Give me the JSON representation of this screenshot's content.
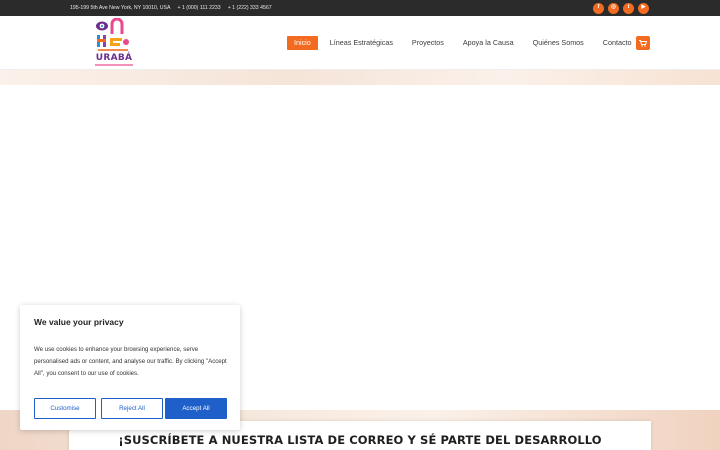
{
  "topbar": {
    "address": "195-199 5th Ave New York, NY 10010, USA",
    "phone1": "+ 1 (000) 111 2233",
    "phone2": "+ 1 (222) 333 4567",
    "social": [
      {
        "icon": "facebook-icon",
        "glyph": "f"
      },
      {
        "icon": "instagram-icon",
        "glyph": "◎"
      },
      {
        "icon": "twitter-icon",
        "glyph": "t"
      },
      {
        "icon": "youtube-icon",
        "glyph": "▶"
      }
    ]
  },
  "header": {
    "logo_text": "URABÁ",
    "nav": [
      {
        "label": "Inicio",
        "active": true
      },
      {
        "label": "Líneas Estratégicas",
        "active": false
      },
      {
        "label": "Proyectos",
        "active": false
      },
      {
        "label": "Apoya la Causa",
        "active": false
      },
      {
        "label": "Quiénes Somos",
        "active": false
      },
      {
        "label": "Contacto",
        "active": false
      }
    ],
    "cart_icon": "cart-icon"
  },
  "newsletter": {
    "title": "¡SUSCRÍBETE A NUESTRA LISTA DE CORREO Y SÉ PARTE DEL DESARROLLO"
  },
  "cookie": {
    "title": "We value your privacy",
    "text": "We use cookies to enhance your browsing experience, serve personalised ads or content, and analyse our traffic. By clicking \"Accept All\", you consent to our use of cookies.",
    "customise_label": "Customise",
    "reject_label": "Reject All",
    "accept_label": "Accept All"
  },
  "colors": {
    "accent": "#f26b21",
    "topbar": "#2b2b2b",
    "consent_blue": "#1e5fc9",
    "logo_purple": "#6b2d8e"
  }
}
